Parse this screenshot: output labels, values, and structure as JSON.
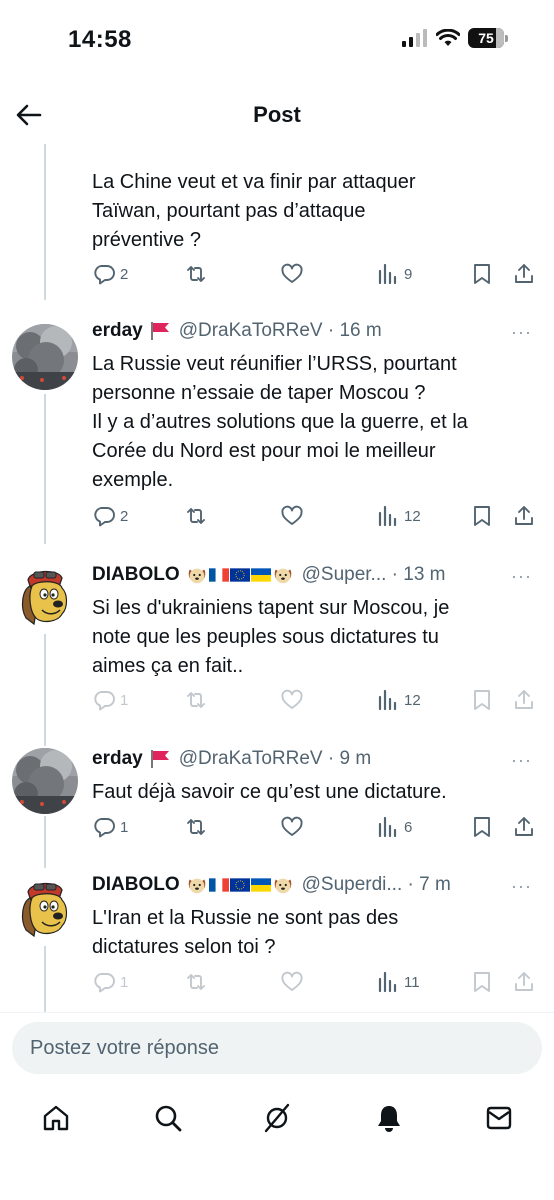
{
  "status_bar": {
    "time": "14:58",
    "battery": "75"
  },
  "header": {
    "title": "Post"
  },
  "posts": [
    {
      "text_lines": [
        "La Chine veut et va finir par attaquer",
        "Taïwan, pourtant pas d’attaque",
        "préventive ?"
      ],
      "replies": "2",
      "views": "9"
    },
    {
      "author": "erday",
      "handle": "@DraKaToRReV · 16 m",
      "text_lines": [
        "La Russie veut réunifier l’URSS, pourtant",
        "personne n’essaie de taper Moscou ?",
        "Il y a d’autres solutions que la guerre, et la",
        "Corée du Nord est pour moi le meilleur",
        "exemple."
      ],
      "replies": "2",
      "views": "12"
    },
    {
      "author": "DIABOLO",
      "handle": "@Super... · 13 m",
      "text_lines": [
        "Si les d'ukrainiens tapent sur Moscou, je",
        "note que les peuples sous dictatures tu",
        "aimes ça en fait.."
      ],
      "replies": "1",
      "views": "12"
    },
    {
      "author": "erday",
      "handle": "@DraKaToRReV · 9 m",
      "text_lines": [
        "Faut déjà savoir ce qu’est une dictature."
      ],
      "replies": "1",
      "views": "6"
    },
    {
      "author": "DIABOLO",
      "handle": "@Superdi... · 7 m",
      "text_lines": [
        "L'Iran et la Russie ne sont pas des",
        "dictatures selon toi ?"
      ],
      "replies": "1",
      "views": "11"
    }
  ],
  "more_label": "···",
  "reply_box": {
    "placeholder": "Postez votre réponse"
  },
  "icons": {
    "back": "arrow-left-icon",
    "reply": "speech-bubble-icon",
    "repost": "repost-icon",
    "like": "heart-icon",
    "views": "bar-chart-icon",
    "bookmark": "bookmark-icon",
    "share": "share-icon",
    "nav": [
      "home-icon",
      "search-icon",
      "grok-icon",
      "bell-icon",
      "mail-icon"
    ]
  },
  "colors": {
    "text": "#0f1419",
    "secondary": "#536471",
    "line": "#cfd9de",
    "reply_box": "#eff3f4"
  }
}
